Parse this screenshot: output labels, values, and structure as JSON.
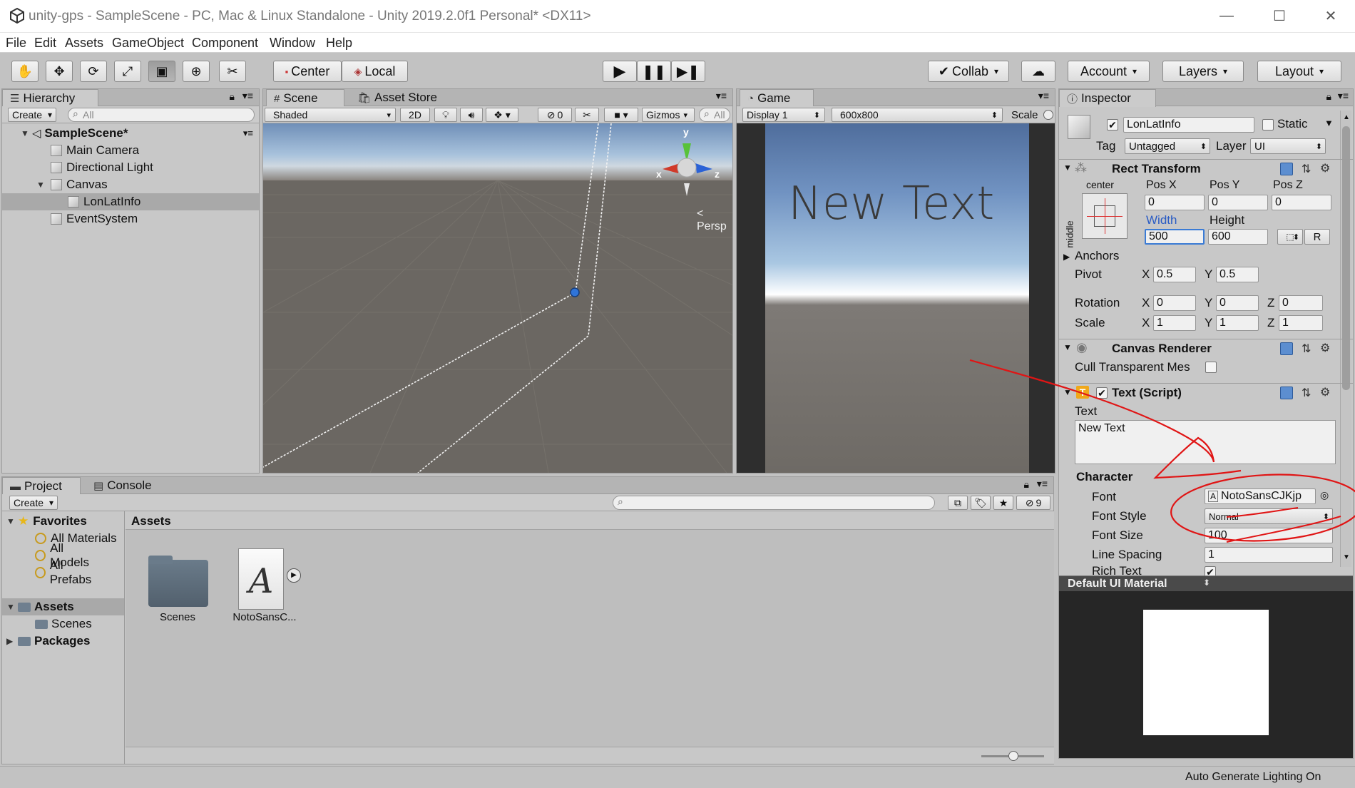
{
  "window": {
    "title": "unity-gps - SampleScene - PC, Mac & Linux Standalone - Unity 2019.2.0f1 Personal* <DX11>",
    "minimize": "—",
    "maximize": "☐",
    "close": "✕"
  },
  "menu": [
    "File",
    "Edit",
    "Assets",
    "GameObject",
    "Component",
    "Window",
    "Help"
  ],
  "toolbar": {
    "center": "Center",
    "local": "Local",
    "collab": "Collab",
    "account": "Account",
    "layers": "Layers",
    "layout": "Layout"
  },
  "hierarchy": {
    "tab": "Hierarchy",
    "create": "Create",
    "search_placeholder": "All",
    "scene": "SampleScene*",
    "items": [
      "Main Camera",
      "Directional Light",
      "Canvas",
      "LonLatInfo",
      "EventSystem"
    ]
  },
  "scene": {
    "tab": "Scene",
    "asset_store_tab": "Asset Store",
    "shading": "Shaded",
    "mode2d": "2D",
    "hidden_count": "0",
    "gizmos": "Gizmos",
    "search_placeholder": "All",
    "axis_x": "x",
    "axis_y": "y",
    "axis_z": "z",
    "persp": "Persp"
  },
  "game": {
    "tab": "Game",
    "display": "Display 1",
    "resolution": "600x800",
    "scale": "Scale",
    "text": "New Text"
  },
  "inspector": {
    "tab": "Inspector",
    "object_name": "LonLatInfo",
    "static": "Static",
    "tag_label": "Tag",
    "tag_value": "Untagged",
    "layer_label": "Layer",
    "layer_value": "UI",
    "rect_transform": {
      "title": "Rect Transform",
      "anchor_h": "center",
      "anchor_v": "middle",
      "pos_x_label": "Pos X",
      "pos_y_label": "Pos Y",
      "pos_z_label": "Pos Z",
      "pos_x": "0",
      "pos_y": "0",
      "pos_z": "0",
      "width_label": "Width",
      "height_label": "Height",
      "width": "500",
      "height": "600",
      "r_button": "R",
      "anchors": "Anchors",
      "pivot": "Pivot",
      "pivot_x": "0.5",
      "pivot_y": "0.5",
      "rotation": "Rotation",
      "rot_x": "0",
      "rot_y": "0",
      "rot_z": "0",
      "scale": "Scale",
      "scale_x": "1",
      "scale_y": "1",
      "scale_z": "1",
      "x": "X",
      "y": "Y",
      "z": "Z"
    },
    "canvas_renderer": {
      "title": "Canvas Renderer",
      "cull": "Cull Transparent Mes"
    },
    "text_script": {
      "title": "Text (Script)",
      "text_label": "Text",
      "text_value": "New Text",
      "character": "Character",
      "font_label": "Font",
      "font_value": "NotoSansCJKjp",
      "font_style_label": "Font Style",
      "font_style_value": "Normal",
      "font_size_label": "Font Size",
      "font_size_value": "100",
      "line_spacing_label": "Line Spacing",
      "line_spacing_value": "1",
      "rich_text_label": "Rich Text"
    },
    "material": "Default UI Material"
  },
  "project": {
    "tab": "Project",
    "console_tab": "Console",
    "create": "Create",
    "hidden_count": "9",
    "favorites": "Favorites",
    "fav_items": [
      "All Materials",
      "All Models",
      "All Prefabs"
    ],
    "assets": "Assets",
    "scenes": "Scenes",
    "packages": "Packages",
    "breadcrumb": "Assets",
    "grid_items": [
      "Scenes",
      "NotoSansC..."
    ],
    "font_glyph": "A"
  },
  "status": "Auto Generate Lighting On",
  "colors": {
    "annotation": "#e01515",
    "sky_top": "#4a6fa0",
    "ground": "#6b6762"
  }
}
